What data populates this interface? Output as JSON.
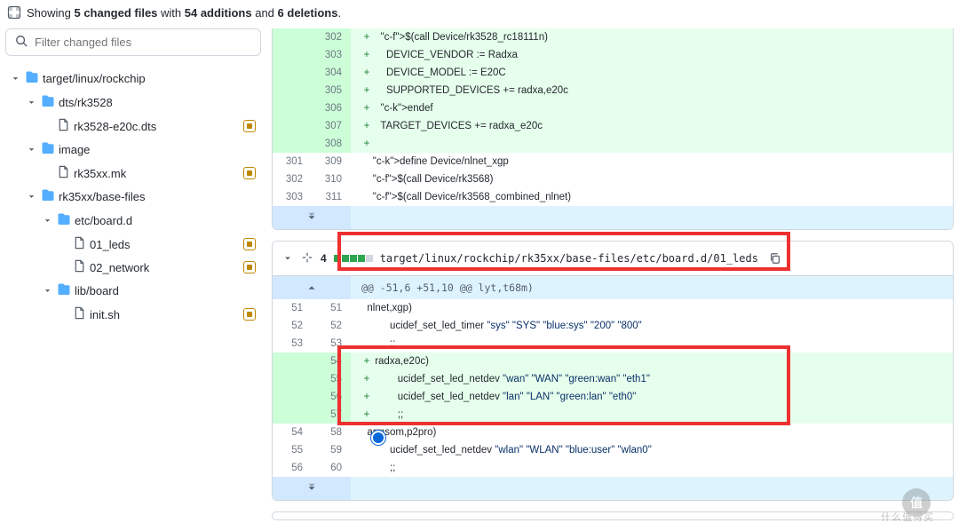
{
  "summary": {
    "prefix": "Showing ",
    "files_count": "5 changed files",
    "middle": " with ",
    "additions": "54 additions",
    "and": " and ",
    "deletions": "6 deletions",
    "suffix": "."
  },
  "filter": {
    "placeholder": "Filter changed files"
  },
  "tree": [
    {
      "type": "folder",
      "depth": 0,
      "label": "target/linux/rockchip"
    },
    {
      "type": "folder",
      "depth": 1,
      "label": "dts/rk3528"
    },
    {
      "type": "file",
      "depth": 2,
      "label": "rk3528-e20c.dts",
      "modified": true
    },
    {
      "type": "folder",
      "depth": 1,
      "label": "image"
    },
    {
      "type": "file",
      "depth": 2,
      "label": "rk35xx.mk",
      "modified": true
    },
    {
      "type": "folder",
      "depth": 1,
      "label": "rk35xx/base-files"
    },
    {
      "type": "folder",
      "depth": 2,
      "label": "etc/board.d"
    },
    {
      "type": "file",
      "depth": 3,
      "label": "01_leds",
      "modified": true
    },
    {
      "type": "file",
      "depth": 3,
      "label": "02_network",
      "modified": true
    },
    {
      "type": "folder",
      "depth": 2,
      "label": "lib/board"
    },
    {
      "type": "file",
      "depth": 3,
      "label": "init.sh",
      "modified": true
    }
  ],
  "file1": {
    "rows": [
      {
        "old": "",
        "new": "302",
        "add": true,
        "text": "  $(call Device/rk3528_rc18111n)"
      },
      {
        "old": "",
        "new": "303",
        "add": true,
        "text": "    DEVICE_VENDOR := Radxa"
      },
      {
        "old": "",
        "new": "304",
        "add": true,
        "text": "    DEVICE_MODEL := E20C"
      },
      {
        "old": "",
        "new": "305",
        "add": true,
        "text": "    SUPPORTED_DEVICES += radxa,e20c"
      },
      {
        "old": "",
        "new": "306",
        "add": true,
        "text": "  endef"
      },
      {
        "old": "",
        "new": "307",
        "add": true,
        "text": "  TARGET_DEVICES += radxa_e20c"
      },
      {
        "old": "",
        "new": "308",
        "add": true,
        "text": ""
      },
      {
        "old": "301",
        "new": "309",
        "add": false,
        "text": "  define Device/nlnet_xgp"
      },
      {
        "old": "302",
        "new": "310",
        "add": false,
        "text": "  $(call Device/rk3568)"
      },
      {
        "old": "303",
        "new": "311",
        "add": false,
        "text": "  $(call Device/rk3568_combined_nlnet)"
      }
    ]
  },
  "file2": {
    "header": {
      "count": "4",
      "path": "target/linux/rockchip/rk35xx/base-files/etc/board.d/01_leds"
    },
    "hunk": "@@ -51,6 +51,10 @@ lyt,t68m)",
    "rows": [
      {
        "old": "51",
        "new": "51",
        "add": false,
        "text": "nlnet,xgp)"
      },
      {
        "old": "52",
        "new": "52",
        "add": false,
        "text": "        ucidef_set_led_timer \"sys\" \"SYS\" \"blue:sys\" \"200\" \"800\""
      },
      {
        "old": "53",
        "new": "53",
        "add": false,
        "text": "        ;;"
      },
      {
        "old": "",
        "new": "54",
        "add": true,
        "text": "radxa,e20c)"
      },
      {
        "old": "",
        "new": "55",
        "add": true,
        "text": "        ucidef_set_led_netdev \"wan\" \"WAN\" \"green:wan\" \"eth1\""
      },
      {
        "old": "",
        "new": "56",
        "add": true,
        "text": "        ucidef_set_led_netdev \"lan\" \"LAN\" \"green:lan\" \"eth0\""
      },
      {
        "old": "",
        "new": "57",
        "add": true,
        "text": "        ;;"
      },
      {
        "old": "54",
        "new": "58",
        "add": false,
        "text": "armsom,p2pro)"
      },
      {
        "old": "55",
        "new": "59",
        "add": false,
        "text": "        ucidef_set_led_netdev \"wlan\" \"WLAN\" \"blue:user\" \"wlan0\""
      },
      {
        "old": "56",
        "new": "60",
        "add": false,
        "text": "        ;;"
      }
    ]
  },
  "watermark": {
    "glyph": "值",
    "text": "什么值得买"
  }
}
